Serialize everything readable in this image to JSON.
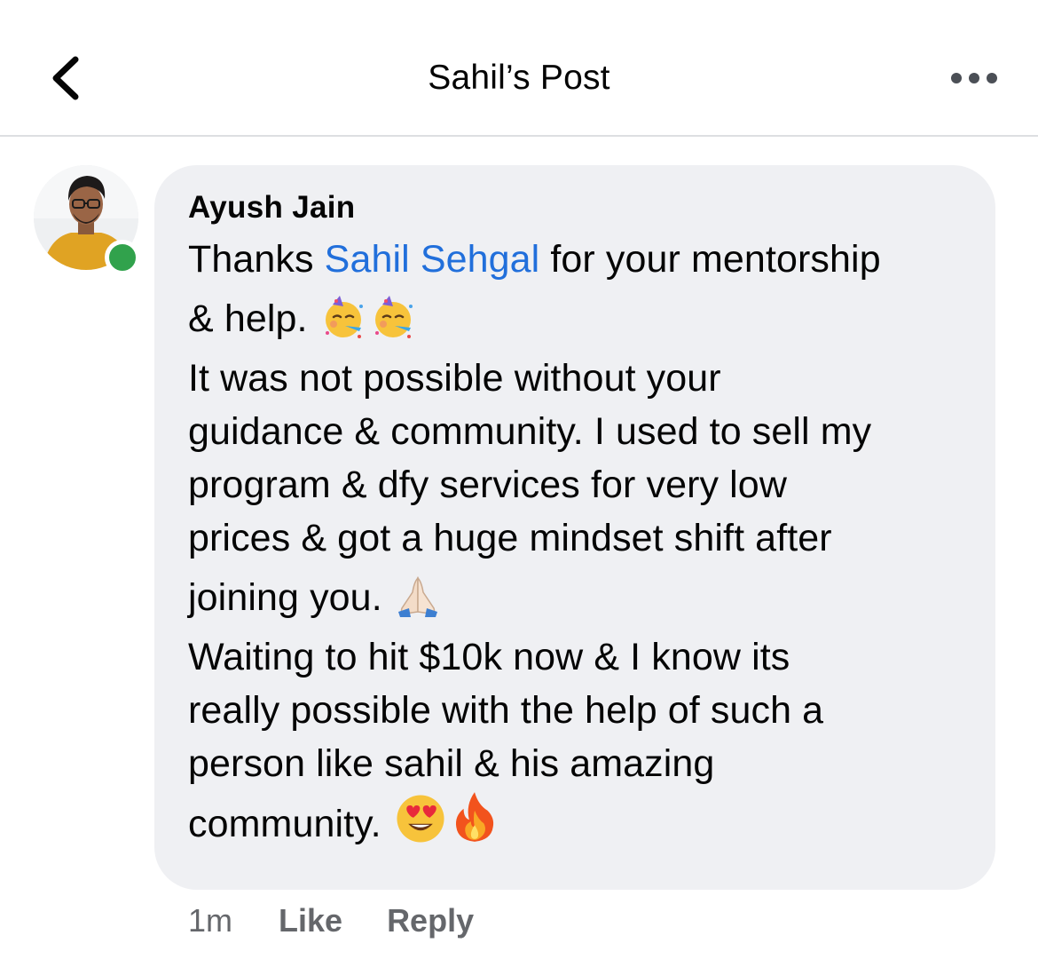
{
  "header": {
    "title": "Sahil’s Post",
    "back_icon": "chevron-left-icon",
    "more_icon": "more-horizontal-icon"
  },
  "comment": {
    "author": "Ayush Jain",
    "online_status_color": "#31a24c",
    "line1_before": "Thanks ",
    "mention": "Sahil Sehgal",
    "line1_after": " for your mentorship",
    "line2": "& help.",
    "line2_emojis": [
      "partying-face-emoji",
      "partying-face-emoji"
    ],
    "line3": "It was not possible without your",
    "line4": "guidance & community. I used to sell my",
    "line5": "program & dfy services for very low",
    "line6": "prices & got a huge mindset shift after",
    "line7": "joining you.",
    "line7_emojis": [
      "folded-hands-emoji"
    ],
    "line8": "Waiting to hit $10k now & I know its",
    "line9": "really possible with the help of such a",
    "line10": "person like sahil & his amazing",
    "line11": "community.",
    "line11_emojis": [
      "heart-eyes-emoji",
      "fire-emoji"
    ]
  },
  "actions": {
    "time": "1m",
    "like": "Like",
    "reply": "Reply"
  },
  "colors": {
    "mention": "#216fdb",
    "bubble": "#eff0f3",
    "meta_text": "#65676b"
  }
}
